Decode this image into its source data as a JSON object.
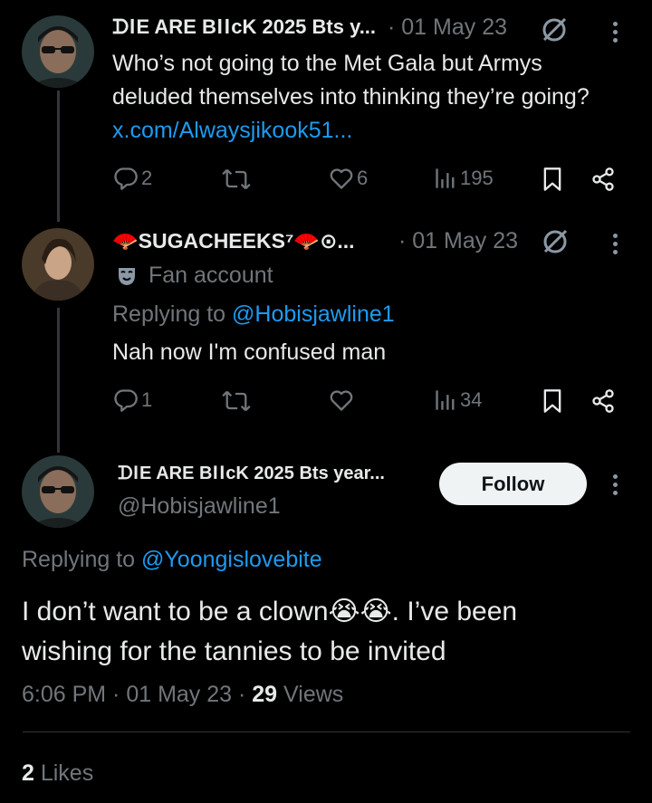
{
  "tweet1": {
    "author_name": "ᗪ𐌉E ARE B𐌉𐌉cK 2025 Bts y...",
    "timestamp": "· 01 May 23",
    "text_before_link": "Who’s not going to the Met Gala but Armys deluded themselves into thinking they’re going?",
    "link": "x.com/Alwaysjikook51...",
    "replies": "2",
    "likes": "6",
    "views": "195"
  },
  "tweet2": {
    "author_name": "🪭SUGACHEEKS⁷🪭⊙...",
    "timestamp": "· 01 May 23",
    "label": "Fan account",
    "replying_prefix": "Replying to",
    "replying_handle": "@Hobisjawline1",
    "text": "Nah now I'm confused man",
    "replies": "1",
    "views": "34"
  },
  "main": {
    "author_name": "ᗪ𐌉E ARE B𐌉𐌉cK 2025 Bts year...",
    "handle": "@Hobisjawline1",
    "follow_label": "Follow",
    "replying_prefix": "Replying to",
    "replying_handle": "@Yoongislovebite",
    "text_line1": "I don’t want to be a clown😭😭. I’ve been",
    "text_line2": "wishing for the tannies to be invited",
    "time": "6:06 PM · 01 May 23 · ",
    "views_count": "29",
    "views_label": " Views",
    "likes_count": "2",
    "likes_label": " Likes"
  },
  "icons": [
    "reply-icon",
    "retweet-icon",
    "like-icon",
    "views-icon",
    "bookmark-icon",
    "share-icon",
    "more-icon",
    "grok-icon",
    "mask-icon"
  ],
  "colors": {
    "background": "#000000",
    "text": "#e7e9ea",
    "muted": "#71767b",
    "link": "#1d9bf0",
    "follow_bg": "#eff3f4"
  }
}
